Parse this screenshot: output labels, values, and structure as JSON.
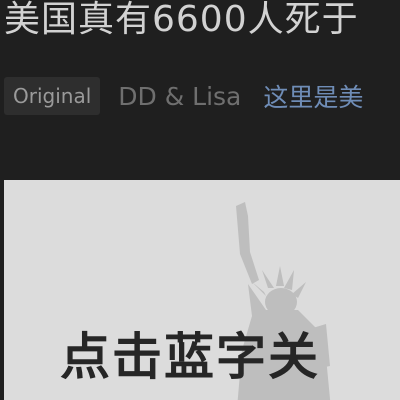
{
  "article": {
    "title": "美国真有6600人死于",
    "tag": "Original",
    "author": "DD & Lisa",
    "account_link": "这里是美"
  },
  "banner": {
    "text": "点击蓝字关",
    "icon": "statue-of-liberty-icon"
  },
  "colors": {
    "background": "#1f1f1f",
    "title": "#d2d2d2",
    "link": "#6f8db7",
    "image_background": "#dcdcdc"
  }
}
